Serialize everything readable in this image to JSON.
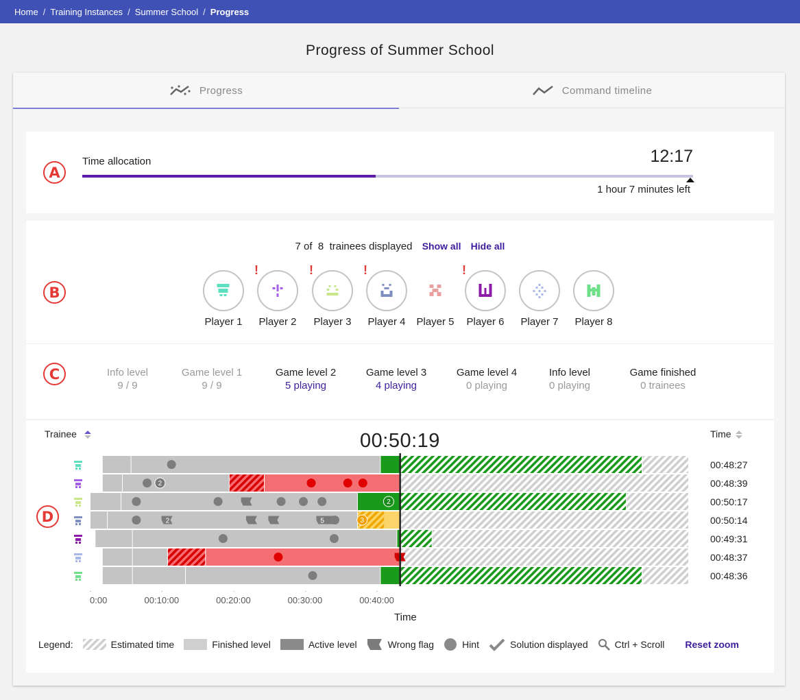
{
  "breadcrumb": [
    "Home",
    "Training Instances",
    "Summer School",
    "Progress"
  ],
  "page_title": "Progress of Summer School",
  "tabs": [
    {
      "label": "Progress",
      "icon": "progress-icon",
      "active": true
    },
    {
      "label": "Command timeline",
      "icon": "timeline-icon",
      "active": false
    }
  ],
  "section_markers": [
    "A",
    "B",
    "C",
    "D"
  ],
  "time_allocation": {
    "label": "Time allocation",
    "time": "12:17",
    "remaining": "1 hour 7 minutes left",
    "progress_fraction": 0.48
  },
  "trainees": {
    "displayed": "7",
    "of_label": "of",
    "total": "8",
    "suffix": "trainees displayed",
    "show_all": "Show all",
    "hide_all": "Hide all",
    "players": [
      {
        "name": "Player 1",
        "warning": false,
        "color": "#5ee0c0"
      },
      {
        "name": "Player 2",
        "warning": true,
        "color": "#a45ee8"
      },
      {
        "name": "Player 3",
        "warning": true,
        "color": "#c8e68a"
      },
      {
        "name": "Player 4",
        "warning": true,
        "color": "#7f8fc2"
      },
      {
        "name": "Player 5",
        "warning": false,
        "color": "#e8a0a0"
      },
      {
        "name": "Player 6",
        "warning": true,
        "color": "#8e1ba8"
      },
      {
        "name": "Player 7",
        "warning": false,
        "color": "#a9b8e8"
      },
      {
        "name": "Player 8",
        "warning": false,
        "color": "#6ee08a"
      }
    ],
    "warning_symbol": "!"
  },
  "levels": [
    {
      "name": "Info level",
      "count": "9 / 9",
      "state": "done"
    },
    {
      "name": "Game level 1",
      "count": "9 / 9",
      "state": "done"
    },
    {
      "name": "Game level 2",
      "count": "5 playing",
      "state": "active"
    },
    {
      "name": "Game level 3",
      "count": "4 playing",
      "state": "active"
    },
    {
      "name": "Game level 4",
      "count": "0 playing",
      "state": "idle"
    },
    {
      "name": "Info level",
      "count": "0 playing",
      "state": "idle"
    },
    {
      "name": "Game finished",
      "count": "0 trainees",
      "state": "idle"
    }
  ],
  "timeline": {
    "trainee_header": "Trainee",
    "time_header": "Time",
    "clock": "00:50:19",
    "x_axis_title": "Time",
    "x_ticks": [
      "0:00",
      "00:10:00",
      "00:20:00",
      "00:30:00",
      "00:40:00"
    ],
    "x_tick_minutes": [
      0,
      10,
      20,
      30,
      40
    ],
    "current_minute": 43.2,
    "max_minute": 83.5,
    "rows": [
      {
        "player": "Player 1",
        "time": "00:48:27",
        "segments": [
          {
            "from": 1.7,
            "to": 5.7,
            "kind": "finished"
          },
          {
            "from": 5.7,
            "to": 40.5,
            "kind": "finished"
          },
          {
            "from": 40.5,
            "to": 43.2,
            "kind": "active-green"
          },
          {
            "from": 43.2,
            "to": 77.0,
            "kind": "est-green"
          },
          {
            "from": 77.0,
            "to": 83.5,
            "kind": "est-grey"
          }
        ],
        "hints": [
          11.3
        ],
        "numbered": [],
        "flags": []
      },
      {
        "player": "Player 2",
        "time": "00:48:39",
        "segments": [
          {
            "from": 1.7,
            "to": 4.5,
            "kind": "finished"
          },
          {
            "from": 4.5,
            "to": 19.4,
            "kind": "finished"
          },
          {
            "from": 19.4,
            "to": 24.3,
            "kind": "est-red"
          },
          {
            "from": 24.3,
            "to": 43.2,
            "kind": "active-red"
          },
          {
            "from": 43.2,
            "to": 83.5,
            "kind": "est-grey"
          }
        ],
        "hints": [
          7.9
        ],
        "numbered": [
          {
            "at": 9.7,
            "n": "2",
            "color": "#777"
          }
        ],
        "red_hints": [
          30.8,
          35.9,
          38.0
        ],
        "flags": []
      },
      {
        "player": "Player 3",
        "time": "00:50:17",
        "segments": [
          {
            "from": 0,
            "to": 4.3,
            "kind": "finished"
          },
          {
            "from": 4.3,
            "to": 37.3,
            "kind": "finished"
          },
          {
            "from": 37.3,
            "to": 43.2,
            "kind": "active-green"
          },
          {
            "from": 43.2,
            "to": 74.8,
            "kind": "est-green"
          },
          {
            "from": 74.8,
            "to": 83.5,
            "kind": "est-grey"
          }
        ],
        "hints": [
          6.4,
          17.8,
          26.6,
          29.7,
          32.3
        ],
        "numbered": [
          {
            "at": 41.6,
            "n": "2",
            "color": "#1a8a1a"
          }
        ],
        "flags": [
          21.2
        ]
      },
      {
        "player": "Player 4",
        "time": "00:50:14",
        "segments": [
          {
            "from": 0,
            "to": 2.4,
            "kind": "finished"
          },
          {
            "from": 2.4,
            "to": 37.3,
            "kind": "finished"
          },
          {
            "from": 37.3,
            "to": 43.2,
            "kind": "active-yellow"
          },
          {
            "from": 43.2,
            "to": 83.5,
            "kind": "est-grey"
          }
        ],
        "hints": [
          6.4,
          34.1
        ],
        "numbered": [
          {
            "at": 37.9,
            "n": "3",
            "color": "#f0a000"
          }
        ],
        "flags": [
          10.1,
          21.9,
          25.0,
          31.7,
          32.1,
          33.0
        ],
        "flag_labels": [
          {
            "at": 10.1,
            "n": "2"
          },
          {
            "at": 31.7,
            "n": "5"
          }
        ]
      },
      {
        "player": "Player 6",
        "time": "00:49:31",
        "segments": [
          {
            "from": 0.7,
            "to": 5.9,
            "kind": "finished"
          },
          {
            "from": 5.9,
            "to": 42.8,
            "kind": "finished"
          },
          {
            "from": 42.8,
            "to": 43.2,
            "kind": "active-green"
          },
          {
            "from": 43.2,
            "to": 47.7,
            "kind": "est-green"
          },
          {
            "from": 47.7,
            "to": 83.5,
            "kind": "est-grey"
          }
        ],
        "hints": [
          18.5,
          34.0
        ],
        "numbered": [],
        "flags": []
      },
      {
        "player": "Player 7",
        "time": "00:48:37",
        "segments": [
          {
            "from": 1.7,
            "to": 5.9,
            "kind": "finished"
          },
          {
            "from": 5.9,
            "to": 10.8,
            "kind": "finished"
          },
          {
            "from": 10.8,
            "to": 16.1,
            "kind": "est-red"
          },
          {
            "from": 16.1,
            "to": 43.2,
            "kind": "active-red"
          },
          {
            "from": 43.2,
            "to": 83.5,
            "kind": "est-grey"
          }
        ],
        "hints": [],
        "red_hints": [
          26.2
        ],
        "numbered": [],
        "flags": [],
        "red_flags": [
          43.2
        ]
      },
      {
        "player": "Player 8",
        "time": "00:48:36",
        "segments": [
          {
            "from": 1.7,
            "to": 5.9,
            "kind": "finished"
          },
          {
            "from": 5.9,
            "to": 13.3,
            "kind": "finished"
          },
          {
            "from": 13.3,
            "to": 40.5,
            "kind": "finished"
          },
          {
            "from": 40.5,
            "to": 43.2,
            "kind": "active-green"
          },
          {
            "from": 43.2,
            "to": 77.0,
            "kind": "est-green"
          },
          {
            "from": 77.0,
            "to": 83.5,
            "kind": "est-grey"
          }
        ],
        "hints": [
          31.0
        ],
        "numbered": [],
        "flags": []
      }
    ]
  },
  "legend": {
    "title": "Legend:",
    "items": [
      {
        "label": "Estimated time",
        "icon": "estimated-swatch"
      },
      {
        "label": "Finished level",
        "icon": "finished-swatch"
      },
      {
        "label": "Active level",
        "icon": "active-swatch"
      },
      {
        "label": "Wrong flag",
        "icon": "flag-icon"
      },
      {
        "label": "Hint",
        "icon": "hint-dot"
      },
      {
        "label": "Solution displayed",
        "icon": "check-icon"
      },
      {
        "label": "Ctrl + Scroll",
        "icon": "zoom-icon"
      }
    ],
    "reset_zoom": "Reset zoom"
  },
  "colors": {
    "accent": "#3f51b5",
    "link": "#3d1d9e",
    "warning": "#e53935",
    "green": "#1a9a1a",
    "red": "#f46f73",
    "finished": "#c4c4c4"
  }
}
